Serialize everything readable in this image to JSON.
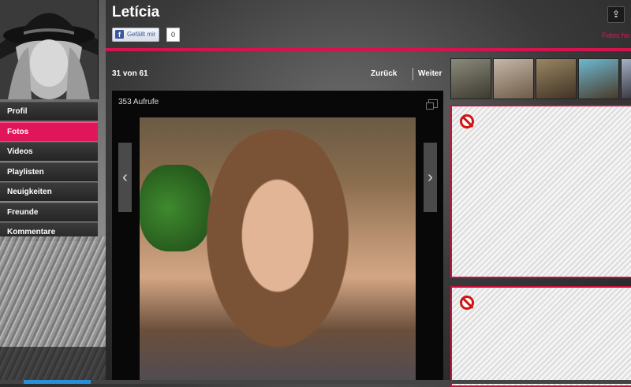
{
  "profile": {
    "name": "Letícia"
  },
  "like": {
    "label": "Gefällt mir",
    "count": "0"
  },
  "header_link": "Fotos ho",
  "nav": {
    "items": [
      {
        "label": "Profil"
      },
      {
        "label": "Fotos"
      },
      {
        "label": "Videos"
      },
      {
        "label": "Playlisten"
      },
      {
        "label": "Neuigkeiten"
      },
      {
        "label": "Freunde"
      },
      {
        "label": "Kommentare"
      }
    ],
    "active": "Fotos"
  },
  "photo_nav": {
    "counter": "31 von 61",
    "prev": "Zurück",
    "next": "Weiter"
  },
  "viewer": {
    "views": "353 Aufrufe"
  },
  "icons": {
    "share": "share-icon",
    "expand": "expand-icon",
    "prev_arrow": "chevron-left-icon",
    "next_arrow": "chevron-right-icon",
    "blocked": "blocked-icon",
    "facebook": "facebook-icon"
  },
  "colors": {
    "accent": "#d3144f",
    "nav_active": "#e1155a",
    "facebook": "#3b5998"
  }
}
